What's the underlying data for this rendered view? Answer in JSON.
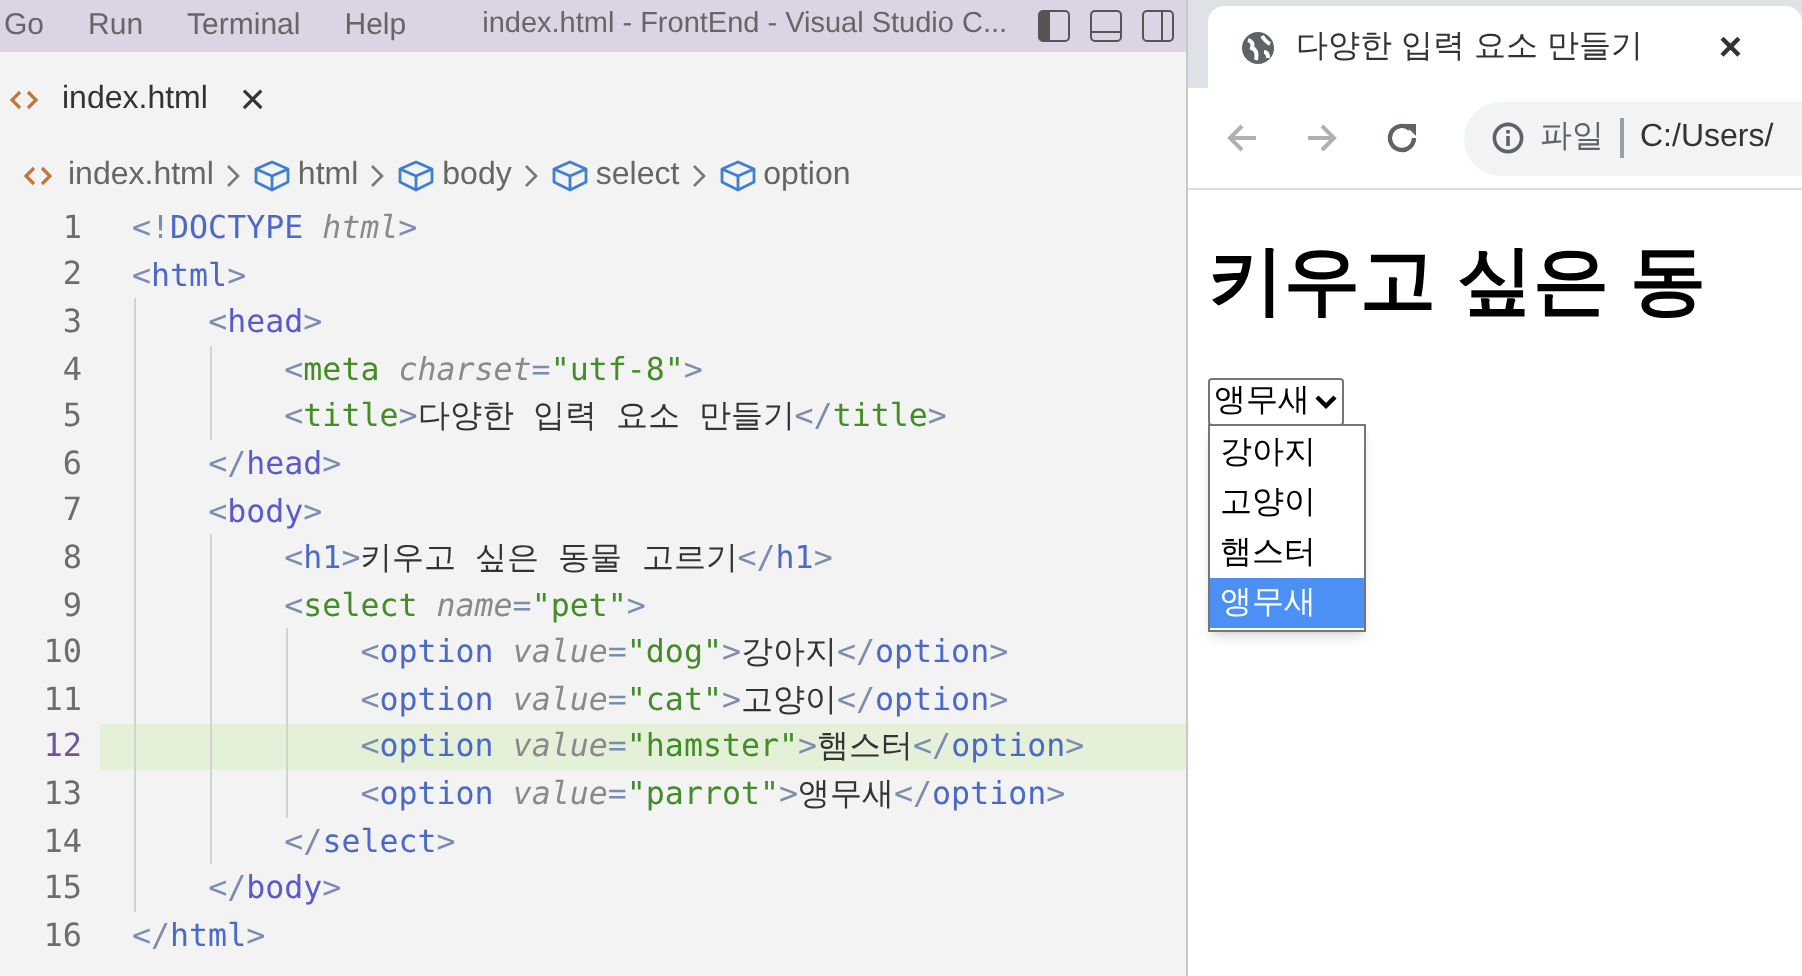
{
  "editor": {
    "menu": [
      "Go",
      "Run",
      "Terminal",
      "Help"
    ],
    "window_title": "index.html - FrontEnd - Visual Studio C...",
    "tab": {
      "label": "index.html",
      "close": "×"
    },
    "breadcrumbs": [
      {
        "label": "index.html",
        "kind": "file"
      },
      {
        "label": "html",
        "kind": "element"
      },
      {
        "label": "body",
        "kind": "element"
      },
      {
        "label": "select",
        "kind": "element"
      },
      {
        "label": "option",
        "kind": "element"
      }
    ],
    "lines": [
      {
        "number": "1",
        "current": false,
        "tokens": [
          {
            "kind": "punct",
            "text": "<!"
          },
          {
            "kind": "tag",
            "text": "DOCTYPE",
            "color": "#4b69c6"
          },
          {
            "kind": "attr",
            "text": "html"
          },
          {
            "kind": "punct",
            "text": ">"
          }
        ]
      },
      {
        "number": "2",
        "current": false,
        "tokens": [
          {
            "kind": "punct",
            "text": "<"
          },
          {
            "kind": "tag",
            "text": "html",
            "color": "#4b69c6"
          },
          {
            "kind": "punct",
            "text": ">"
          }
        ],
        "children": [
          {
            "number": "3",
            "current": false,
            "tokens": [
              {
                "kind": "punct",
                "text": "<"
              },
              {
                "kind": "tag",
                "text": "head",
                "color": "#5a5acd"
              },
              {
                "kind": "punct",
                "text": ">"
              }
            ],
            "children": [
              {
                "number": "4",
                "current": false,
                "tokens": [
                  {
                    "kind": "punct",
                    "text": "<"
                  },
                  {
                    "kind": "tag",
                    "text": "meta",
                    "color": "#448c27"
                  },
                  {
                    "kind": "attr",
                    "text": "charset"
                  },
                  {
                    "kind": "punct",
                    "text": "="
                  },
                  {
                    "kind": "string",
                    "text": "\"utf-8\""
                  },
                  {
                    "kind": "punct",
                    "text": ">"
                  }
                ]
              },
              {
                "number": "5",
                "current": false,
                "tokens": [
                  {
                    "kind": "punct",
                    "text": "<"
                  },
                  {
                    "kind": "tag",
                    "text": "title",
                    "color": "#448c27"
                  },
                  {
                    "kind": "punct",
                    "text": ">"
                  },
                  {
                    "kind": "text",
                    "text": "다양한 입력 요소 만들기"
                  },
                  {
                    "kind": "punct",
                    "text": "</"
                  },
                  {
                    "kind": "tag",
                    "text": "title",
                    "color": "#448c27"
                  },
                  {
                    "kind": "punct",
                    "text": ">"
                  }
                ]
              }
            ]
          },
          {
            "number": "6",
            "current": false,
            "tokens": [
              {
                "kind": "punct",
                "text": "</"
              },
              {
                "kind": "tag",
                "text": "head",
                "color": "#5a5acd"
              },
              {
                "kind": "punct",
                "text": ">"
              }
            ]
          },
          {
            "number": "7",
            "current": false,
            "tokens": [
              {
                "kind": "punct",
                "text": "<"
              },
              {
                "kind": "tag",
                "text": "body",
                "color": "#5a5acd"
              },
              {
                "kind": "punct",
                "text": ">"
              }
            ],
            "children": [
              {
                "number": "8",
                "current": false,
                "tokens": [
                  {
                    "kind": "punct",
                    "text": "<"
                  },
                  {
                    "kind": "tag",
                    "text": "h1",
                    "color": "#4b69c6"
                  },
                  {
                    "kind": "punct",
                    "text": ">"
                  },
                  {
                    "kind": "text",
                    "text": "키우고 싶은 동물 고르기"
                  },
                  {
                    "kind": "punct",
                    "text": "</"
                  },
                  {
                    "kind": "tag",
                    "text": "h1",
                    "color": "#4b69c6"
                  },
                  {
                    "kind": "punct",
                    "text": ">"
                  }
                ]
              },
              {
                "number": "9",
                "current": false,
                "tokens": [
                  {
                    "kind": "punct",
                    "text": "<"
                  },
                  {
                    "kind": "tag",
                    "text": "select",
                    "color": "#448c27"
                  },
                  {
                    "kind": "attr",
                    "text": "name"
                  },
                  {
                    "kind": "punct",
                    "text": "="
                  },
                  {
                    "kind": "string",
                    "text": "\"pet\""
                  },
                  {
                    "kind": "punct",
                    "text": ">"
                  }
                ],
                "children": [
                  {
                    "number": "10",
                    "current": false,
                    "tokens": [
                      {
                        "kind": "punct",
                        "text": "<"
                      },
                      {
                        "kind": "tag",
                        "text": "option",
                        "color": "#4b69c6"
                      },
                      {
                        "kind": "attr",
                        "text": "value"
                      },
                      {
                        "kind": "punct",
                        "text": "="
                      },
                      {
                        "kind": "string",
                        "text": "\"dog\""
                      },
                      {
                        "kind": "punct",
                        "text": ">"
                      },
                      {
                        "kind": "text",
                        "text": "강아지"
                      },
                      {
                        "kind": "punct",
                        "text": "</"
                      },
                      {
                        "kind": "tag",
                        "text": "option",
                        "color": "#4b69c6"
                      },
                      {
                        "kind": "punct",
                        "text": ">"
                      }
                    ]
                  },
                  {
                    "number": "11",
                    "current": false,
                    "tokens": [
                      {
                        "kind": "punct",
                        "text": "<"
                      },
                      {
                        "kind": "tag",
                        "text": "option",
                        "color": "#4b69c6"
                      },
                      {
                        "kind": "attr",
                        "text": "value"
                      },
                      {
                        "kind": "punct",
                        "text": "="
                      },
                      {
                        "kind": "string",
                        "text": "\"cat\""
                      },
                      {
                        "kind": "punct",
                        "text": ">"
                      },
                      {
                        "kind": "text",
                        "text": "고양이"
                      },
                      {
                        "kind": "punct",
                        "text": "</"
                      },
                      {
                        "kind": "tag",
                        "text": "option",
                        "color": "#4b69c6"
                      },
                      {
                        "kind": "punct",
                        "text": ">"
                      }
                    ]
                  },
                  {
                    "number": "12",
                    "current": true,
                    "tokens": [
                      {
                        "kind": "punct",
                        "text": "<"
                      },
                      {
                        "kind": "tag",
                        "text": "option",
                        "color": "#4b69c6"
                      },
                      {
                        "kind": "attr",
                        "text": "value"
                      },
                      {
                        "kind": "punct",
                        "text": "="
                      },
                      {
                        "kind": "string",
                        "text": "\"hamster\""
                      },
                      {
                        "kind": "punct",
                        "text": ">"
                      },
                      {
                        "kind": "text",
                        "text": "햄스터"
                      },
                      {
                        "kind": "punct",
                        "text": "</"
                      },
                      {
                        "kind": "tag",
                        "text": "option",
                        "color": "#4b69c6"
                      },
                      {
                        "kind": "punct",
                        "text": ">"
                      }
                    ]
                  },
                  {
                    "number": "13",
                    "current": false,
                    "tokens": [
                      {
                        "kind": "punct",
                        "text": "<"
                      },
                      {
                        "kind": "tag",
                        "text": "option",
                        "color": "#4b69c6"
                      },
                      {
                        "kind": "attr",
                        "text": "value"
                      },
                      {
                        "kind": "punct",
                        "text": "="
                      },
                      {
                        "kind": "string",
                        "text": "\"parrot\""
                      },
                      {
                        "kind": "punct",
                        "text": ">"
                      },
                      {
                        "kind": "text",
                        "text": "앵무새"
                      },
                      {
                        "kind": "punct",
                        "text": "</"
                      },
                      {
                        "kind": "tag",
                        "text": "option",
                        "color": "#4b69c6"
                      },
                      {
                        "kind": "punct",
                        "text": ">"
                      }
                    ]
                  }
                ]
              },
              {
                "number": "14",
                "current": false,
                "tokens": [
                  {
                    "kind": "punct",
                    "text": "</"
                  },
                  {
                    "kind": "tag",
                    "text": "select",
                    "color": "#4b69c6"
                  },
                  {
                    "kind": "punct",
                    "text": ">"
                  }
                ]
              }
            ]
          },
          {
            "number": "15",
            "current": false,
            "tokens": [
              {
                "kind": "punct",
                "text": "</"
              },
              {
                "kind": "tag",
                "text": "body",
                "color": "#5a5acd"
              },
              {
                "kind": "punct",
                "text": ">"
              }
            ]
          }
        ]
      },
      {
        "number": "16",
        "current": false,
        "tokens": [
          {
            "kind": "punct",
            "text": "</"
          },
          {
            "kind": "tag",
            "text": "html",
            "color": "#4b69c6"
          },
          {
            "kind": "punct",
            "text": ">"
          }
        ]
      }
    ]
  },
  "browser": {
    "tab": {
      "title": "다양한 입력 요소 만들기",
      "close": "×"
    },
    "address": {
      "scheme": "파일",
      "url": "C:/Users/"
    },
    "page": {
      "heading": "키우고 싶은 동",
      "select_value": "앵무새",
      "options": [
        {
          "label": "강아지",
          "selected": false
        },
        {
          "label": "고양이",
          "selected": false
        },
        {
          "label": "햄스터",
          "selected": false
        },
        {
          "label": "앵무새",
          "selected": true
        }
      ]
    }
  }
}
